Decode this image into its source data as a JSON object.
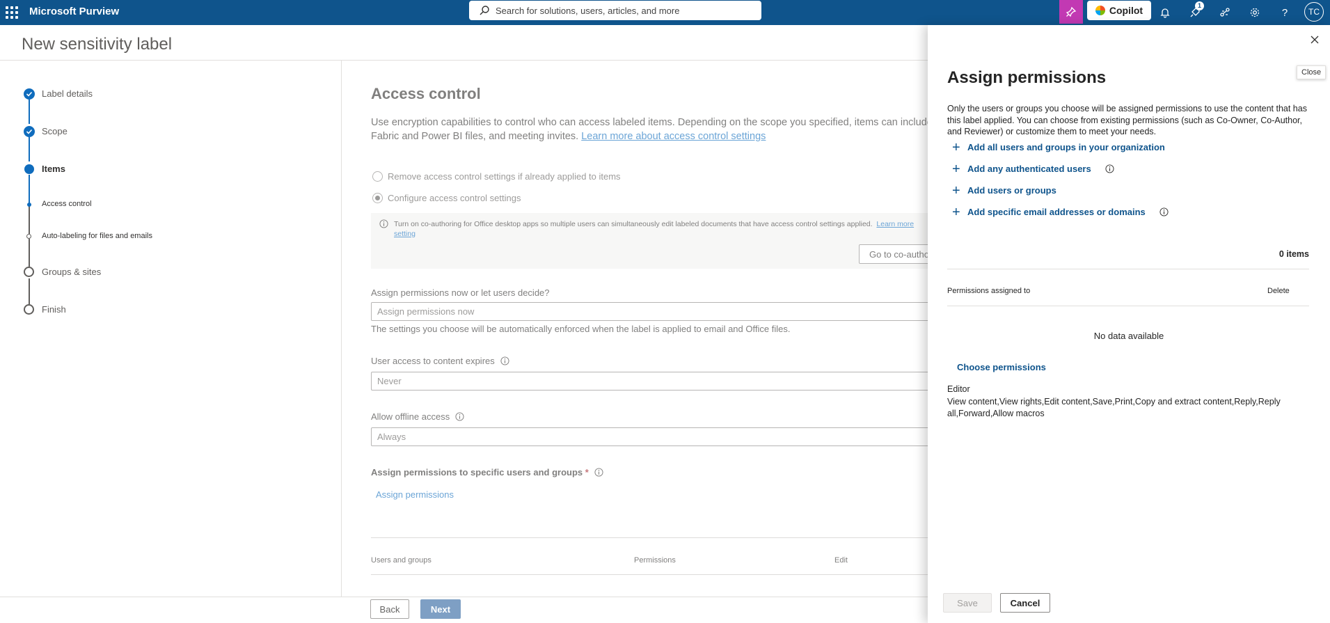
{
  "topbar": {
    "app_name": "Microsoft Purview",
    "search_placeholder": "Search for solutions, users, articles, and more",
    "copilot_label": "Copilot",
    "notifications_badge": "1",
    "avatar_initials": "TC",
    "icons": [
      "waffle-icon",
      "search-icon",
      "copilot-pin-icon",
      "bell-icon",
      "notification-rocket-icon",
      "share-icon",
      "gear-icon",
      "help-icon"
    ]
  },
  "page": {
    "title": "New sensitivity label"
  },
  "stepper": {
    "steps": [
      {
        "label": "Label details",
        "state": "done"
      },
      {
        "label": "Scope",
        "state": "done"
      },
      {
        "label": "Items",
        "state": "current"
      },
      {
        "label": "Access control",
        "state": "current-sub"
      },
      {
        "label": "Auto-labeling for files and emails",
        "state": "pending-sub"
      },
      {
        "label": "Groups & sites",
        "state": "pending"
      },
      {
        "label": "Finish",
        "state": "pending"
      }
    ]
  },
  "main": {
    "heading": "Access control",
    "desc_line1": "Use encryption capabilities to control who can access labeled items. Depending on the scope you specified, items can include",
    "desc_line2": "Fabric and Power BI files, and meeting invites.",
    "desc_link": "Learn more about access control settings",
    "radio_remove": "Remove access control settings if already applied to items",
    "radio_configure": "Configure access control settings",
    "info_line1": "Turn on co-authoring for Office desktop apps so multiple users can simultaneously edit labeled documents that have access control settings applied.",
    "info_link_a": "Learn more",
    "info_link_b": "setting",
    "coauth_button": "Go to co-autho",
    "assign_question": "Assign permissions now or let users decide?",
    "assign_value": "Assign permissions now",
    "assign_help": "The settings you choose will be automatically enforced when the label is applied to email and Office files.",
    "expires_label": "User access to content expires",
    "expires_value": "Never",
    "offline_label": "Allow offline access",
    "offline_value": "Always",
    "specific_label": "Assign permissions to specific users and groups",
    "required_mark": "*",
    "assign_link": "Assign permissions",
    "table_headers": [
      "Users and groups",
      "Permissions",
      "Edit"
    ]
  },
  "footer": {
    "back": "Back",
    "next": "Next"
  },
  "panel": {
    "close_tooltip": "Close",
    "title": "Assign permissions",
    "description": "Only the users or groups you choose will be assigned permissions to use the content that has this label applied. You can choose from existing permissions (such as Co-Owner, Co-Author, and Reviewer) or customize them to meet your needs.",
    "actions": [
      "Add all users and groups in your organization",
      "Add any authenticated users",
      "Add users or groups",
      "Add specific email addresses or domains"
    ],
    "count": "0 items",
    "col_assigned": "Permissions assigned to",
    "col_delete": "Delete",
    "no_data": "No data available",
    "choose_link": "Choose permissions",
    "role": "Editor",
    "role_permissions": "View content,View rights,Edit content,Save,Print,Copy and extract content,Reply,Reply all,Forward,Allow macros",
    "save": "Save",
    "cancel": "Cancel"
  },
  "colors": {
    "topbar": "#0f548c",
    "accent": "#0f6cbd",
    "copilot_pin": "#c239b3"
  }
}
